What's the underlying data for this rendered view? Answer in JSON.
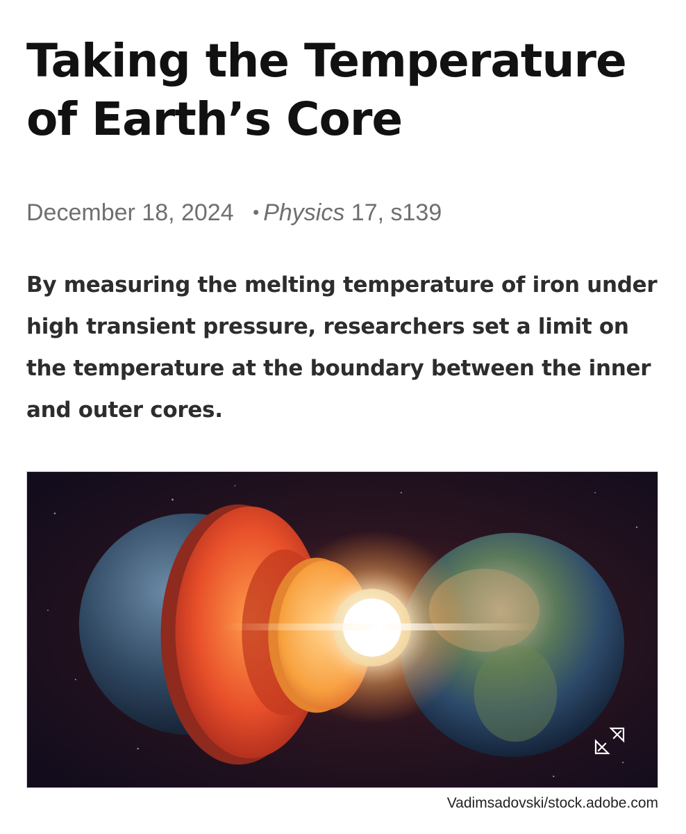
{
  "article": {
    "title": "Taking the Temperature of Earth’s Core",
    "date": "December 18, 2024",
    "separator": "•",
    "journal": "Physics",
    "citation": "17, s139",
    "summary": "By measuring the melting temperature of iron under high transient pressure, researchers set a limit on the temperature at the boundary between the inner and outer cores."
  },
  "figure": {
    "credit": "Vadimsadovski/stock.adobe.com",
    "expand_icon": "expand-arrows-icon"
  }
}
